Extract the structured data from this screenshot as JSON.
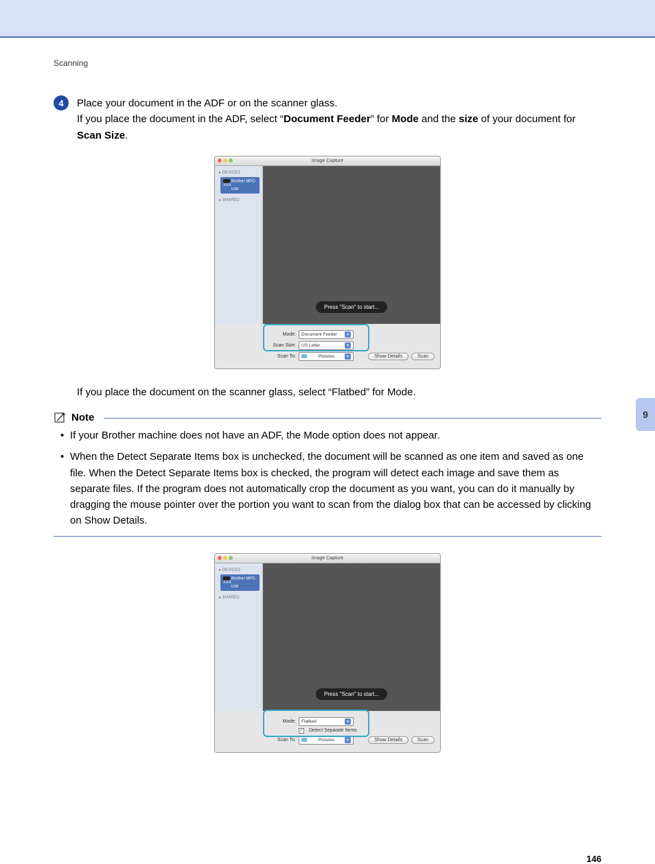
{
  "section": "Scanning",
  "side_tab": "9",
  "page_number": "146",
  "step": {
    "num": "4",
    "t1": "Place your document in the ADF or on the scanner glass.",
    "t2a": "If you place the document in the ADF, select “",
    "t2b_bold": "Document Feeder",
    "t2c": "” for ",
    "t2d_bold": "Mode",
    "t2e": " and the ",
    "t2f_bold": "size",
    "t2g": " of your document for ",
    "t2h_bold": "Scan Size",
    "t2i": "."
  },
  "after": {
    "t1": "If you place the document on the scanner glass, select “",
    "t1b": "Flatbed",
    "t1c": "” for ",
    "t1d": "Mode",
    "t1e": "."
  },
  "note": {
    "label": "Note",
    "li1a": "If your Brother machine does not have an ADF, the ",
    "li1b": "Mode",
    "li1c": " option does not appear.",
    "li2a": "When the ",
    "li2b": "Detect Separate Items",
    "li2c": " box is unchecked, the document will be scanned as one item and saved as one file. When the ",
    "li2d": "Detect Separate Items",
    "li2e": " box is checked, the program will detect each image and save them as separate files. If the program does not automatically crop the document as you want, you can do it manually by dragging the mouse pointer over the portion you want to scan from the dialog box that can be accessed by clicking on ",
    "li2f": "Show Details",
    "li2g": "."
  },
  "ss": {
    "title": "Image Capture",
    "devices": "DEVICES",
    "shared": "SHARED",
    "device_name": "Brother MFC-XXX",
    "device_sub": "USB",
    "press": "Press \"Scan\" to start...",
    "mode_label": "Mode:",
    "scansize_label": "Scan Size:",
    "scanto_label": "Scan To:",
    "mode_val_adf": "Document Feeder",
    "scansize_val": "US Letter",
    "scanto_val": "Pictures",
    "show_details": "Show Details",
    "scan": "Scan",
    "mode_val_flat": "Flatbed",
    "detect_label": "Detect Separate Items",
    "check": "✓"
  }
}
